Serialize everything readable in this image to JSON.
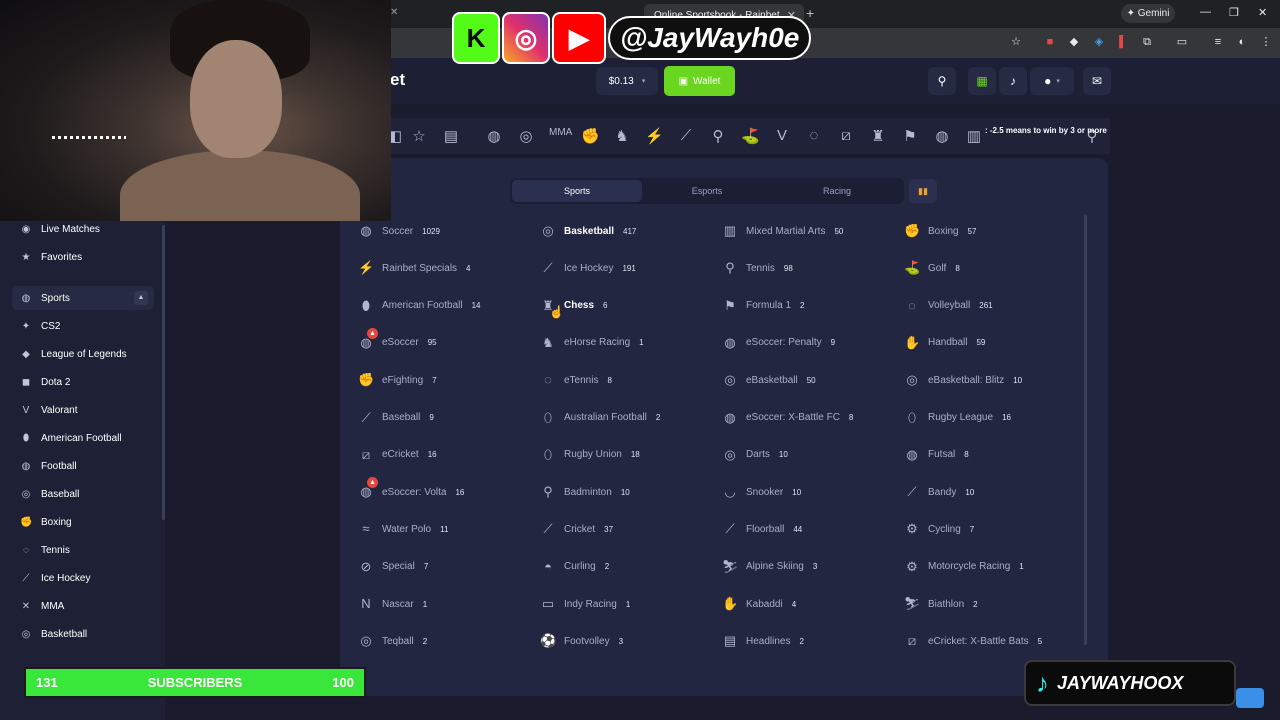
{
  "browser": {
    "active_tab_title": "Online Sportsbook - Rainbet",
    "gemini_label": "Gemini"
  },
  "header": {
    "logo_fragment": "et",
    "balance": "$0.13",
    "wallet_label": "Wallet"
  },
  "ticker_text": ": -2.5 means to win by 3 or more",
  "sidebar": {
    "items": [
      {
        "label": "Live Matches",
        "icon": "live-icon"
      },
      {
        "label": "Favorites",
        "icon": "star-icon"
      },
      {
        "label": "Sports",
        "icon": "ball-icon",
        "active": true
      },
      {
        "label": "CS2",
        "icon": "cs2-icon"
      },
      {
        "label": "League of Legends",
        "icon": "lol-icon"
      },
      {
        "label": "Dota 2",
        "icon": "dota-icon"
      },
      {
        "label": "Valorant",
        "icon": "valorant-icon"
      },
      {
        "label": "American Football",
        "icon": "american-football-icon"
      },
      {
        "label": "Football",
        "icon": "football-icon"
      },
      {
        "label": "Baseball",
        "icon": "baseball-icon"
      },
      {
        "label": "Boxing",
        "icon": "boxing-icon"
      },
      {
        "label": "Tennis",
        "icon": "tennis-icon"
      },
      {
        "label": "Ice Hockey",
        "icon": "ice-hockey-icon"
      },
      {
        "label": "MMA",
        "icon": "mma-icon"
      },
      {
        "label": "Basketball",
        "icon": "basketball-icon"
      }
    ]
  },
  "panel": {
    "tabs": [
      "Sports",
      "Esports",
      "Racing"
    ],
    "active_tab": "Sports",
    "columns": [
      [
        {
          "name": "Soccer",
          "count": "1029"
        },
        {
          "name": "Rainbet Specials",
          "count": "4"
        },
        {
          "name": "American Football",
          "count": "14"
        },
        {
          "name": "eSoccer",
          "count": "95",
          "hot": true
        },
        {
          "name": "eFighting",
          "count": "7"
        },
        {
          "name": "Baseball",
          "count": "9"
        },
        {
          "name": "eCricket",
          "count": "16"
        },
        {
          "name": "eSoccer: Volta",
          "count": "16",
          "hot": true
        },
        {
          "name": "Water Polo",
          "count": "11"
        },
        {
          "name": "Special",
          "count": "7"
        },
        {
          "name": "Nascar",
          "count": "1"
        },
        {
          "name": "Teqball",
          "count": "2"
        }
      ],
      [
        {
          "name": "Basketball",
          "count": "417",
          "highlight": true
        },
        {
          "name": "Ice Hockey",
          "count": "191"
        },
        {
          "name": "Chess",
          "count": "6",
          "highlight": true
        },
        {
          "name": "eHorse Racing",
          "count": "1"
        },
        {
          "name": "eTennis",
          "count": "8"
        },
        {
          "name": "Australian Football",
          "count": "2"
        },
        {
          "name": "Rugby Union",
          "count": "18"
        },
        {
          "name": "Badminton",
          "count": "10"
        },
        {
          "name": "Cricket",
          "count": "37"
        },
        {
          "name": "Curling",
          "count": "2"
        },
        {
          "name": "Indy Racing",
          "count": "1"
        },
        {
          "name": "Footvolley",
          "count": "3"
        }
      ],
      [
        {
          "name": "Mixed Martial Arts",
          "count": "50"
        },
        {
          "name": "Tennis",
          "count": "98"
        },
        {
          "name": "Formula 1",
          "count": "2"
        },
        {
          "name": "eSoccer: Penalty",
          "count": "9"
        },
        {
          "name": "eBasketball",
          "count": "50"
        },
        {
          "name": "eSoccer: X-Battle FC",
          "count": "8"
        },
        {
          "name": "Darts",
          "count": "10"
        },
        {
          "name": "Snooker",
          "count": "10"
        },
        {
          "name": "Floorball",
          "count": "44"
        },
        {
          "name": "Alpine Skiing",
          "count": "3"
        },
        {
          "name": "Kabaddi",
          "count": "4"
        },
        {
          "name": "Headlines",
          "count": "2"
        }
      ],
      [
        {
          "name": "Boxing",
          "count": "57"
        },
        {
          "name": "Golf",
          "count": "8"
        },
        {
          "name": "Volleyball",
          "count": "261"
        },
        {
          "name": "Handball",
          "count": "59"
        },
        {
          "name": "eBasketball: Blitz",
          "count": "10"
        },
        {
          "name": "Rugby League",
          "count": "16"
        },
        {
          "name": "Futsal",
          "count": "8"
        },
        {
          "name": "Bandy",
          "count": "10"
        },
        {
          "name": "Cycling",
          "count": "7"
        },
        {
          "name": "Motorcycle Racing",
          "count": "1"
        },
        {
          "name": "Biathlon",
          "count": "2"
        },
        {
          "name": "eCricket: X-Battle Bats",
          "count": "5"
        }
      ]
    ]
  },
  "overlay": {
    "social_handle": "@JayWayh0e",
    "subs_current": "131",
    "subs_label": "SUBSCRIBERS",
    "subs_goal": "100",
    "tiktok_handle": "JAYWAYHOOX"
  },
  "colors": {
    "accent_green": "#6bd61f",
    "panel_bg": "#232640",
    "hot_badge": "#e8453c"
  }
}
